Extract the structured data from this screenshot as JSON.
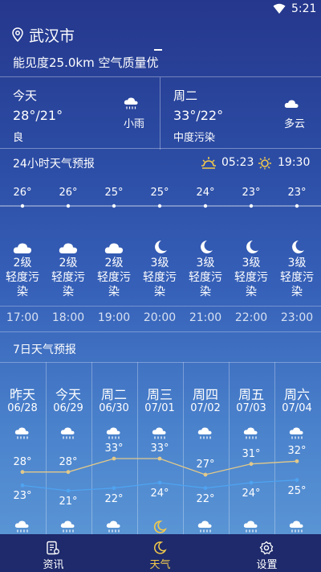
{
  "status": {
    "time": "5:21"
  },
  "location": {
    "city": "武汉市"
  },
  "conditions": {
    "text": "能见度25.0km  空气质量优"
  },
  "today": {
    "name": "今天",
    "temp": "28°/21°",
    "air": "良",
    "weather": "小雨",
    "icon": "cloud-rain-icon"
  },
  "tomorrow": {
    "name": "周二",
    "temp": "33°/22°",
    "air": "中度污染",
    "weather": "多云",
    "icon": "cloud-icon"
  },
  "hourly": {
    "title": "24小时天气预报",
    "sunrise": "05:23",
    "sunset": "19:30",
    "items": [
      {
        "temp": "26°",
        "icon": "cloud-icon",
        "level": "2级",
        "aqi": "轻度污染",
        "time": "17:00"
      },
      {
        "temp": "26°",
        "icon": "cloud-icon",
        "level": "2级",
        "aqi": "轻度污染",
        "time": "18:00"
      },
      {
        "temp": "25°",
        "icon": "cloud-icon",
        "level": "2级",
        "aqi": "轻度污染",
        "time": "19:00"
      },
      {
        "temp": "25°",
        "icon": "moon-icon",
        "level": "3级",
        "aqi": "轻度污染",
        "time": "20:00"
      },
      {
        "temp": "24°",
        "icon": "moon-icon",
        "level": "3级",
        "aqi": "轻度污染",
        "time": "21:00"
      },
      {
        "temp": "23°",
        "icon": "moon-icon",
        "level": "3级",
        "aqi": "轻度污染",
        "time": "22:00"
      },
      {
        "temp": "23°",
        "icon": "moon-icon",
        "level": "3级",
        "aqi": "轻度污染",
        "time": "23:00"
      }
    ]
  },
  "daily": {
    "title": "7日天气预报",
    "days": [
      {
        "name": "昨天",
        "date": "06/28",
        "hi": 28,
        "lo": 23,
        "hi_label": "28°",
        "lo_label": "23°",
        "day_icon": "cloud-rain-icon",
        "night_icon": "cloud-rain-icon"
      },
      {
        "name": "今天",
        "date": "06/29",
        "hi": 28,
        "lo": 21,
        "hi_label": "28°",
        "lo_label": "21°",
        "day_icon": "cloud-rain-icon",
        "night_icon": "cloud-rain-icon"
      },
      {
        "name": "周二",
        "date": "06/30",
        "hi": 33,
        "lo": 22,
        "hi_label": "33°",
        "lo_label": "22°",
        "day_icon": "cloud-rain-icon",
        "night_icon": "cloud-rain-icon"
      },
      {
        "name": "周三",
        "date": "07/01",
        "hi": 33,
        "lo": 24,
        "hi_label": "33°",
        "lo_label": "24°",
        "day_icon": "cloud-rain-icon",
        "night_icon": "moon-icon"
      },
      {
        "name": "周四",
        "date": "07/02",
        "hi": 27,
        "lo": 22,
        "hi_label": "27°",
        "lo_label": "22°",
        "day_icon": "cloud-rain-icon",
        "night_icon": "cloud-rain-icon"
      },
      {
        "name": "周五",
        "date": "07/03",
        "hi": 31,
        "lo": 24,
        "hi_label": "31°",
        "lo_label": "24°",
        "day_icon": "cloud-rain-icon",
        "night_icon": "cloud-rain-icon"
      },
      {
        "name": "周六",
        "date": "07/04",
        "hi": 32,
        "lo": 25,
        "hi_label": "32°",
        "lo_label": "25°",
        "day_icon": "cloud-rain-icon",
        "night_icon": "cloud-rain-icon"
      }
    ],
    "hi_color": "#e2c98a",
    "lo_color": "#4fa3f0"
  },
  "tabs": [
    {
      "label": "资讯",
      "icon": "news-icon",
      "active": false
    },
    {
      "label": "天气",
      "icon": "weather-moon-icon",
      "active": true
    },
    {
      "label": "设置",
      "icon": "settings-icon",
      "active": false
    }
  ]
}
